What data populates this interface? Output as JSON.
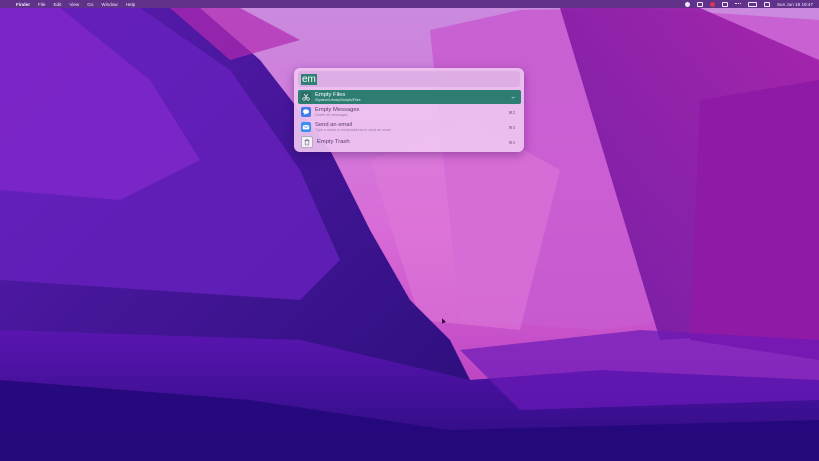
{
  "menubar": {
    "app_name": "Finder",
    "menus": [
      "File",
      "Edit",
      "View",
      "Go",
      "Window",
      "Help"
    ],
    "clock": "Sun Jun 19  19:47"
  },
  "launcher": {
    "query": "em",
    "selection_color": "#2e7d72",
    "results": [
      {
        "title": "Empty Files",
        "subtitle": "/System/Library/Scripts/Files",
        "shortcut": "↩",
        "icon": "scissors-icon",
        "selected": true
      },
      {
        "title": "Empty Messages",
        "subtitle": "Delete all messages",
        "shortcut": "⌘2",
        "icon": "messages-icon",
        "selected": false
      },
      {
        "title": "Send an email",
        "subtitle": "Type a name or email address to send an email",
        "shortcut": "⌘3",
        "icon": "mail-icon",
        "selected": false
      },
      {
        "title": "Empty Trash",
        "subtitle": "",
        "shortcut": "⌘4",
        "icon": "trash-icon",
        "selected": false
      }
    ]
  }
}
